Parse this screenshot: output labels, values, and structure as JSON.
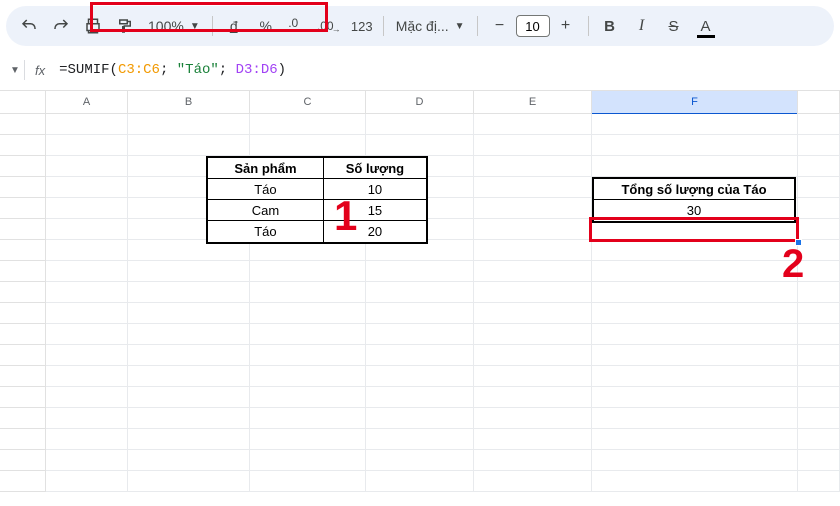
{
  "toolbar": {
    "zoom": "100%",
    "decimal_btn_a": ".0",
    "decimal_btn_b": ".00",
    "num_format": "123",
    "font": "Mặc đị...",
    "size_minus": "−",
    "size_value": "10",
    "size_plus": "+",
    "bold": "B",
    "italic": "I"
  },
  "formula_bar": {
    "fx": "fx",
    "eq": "=",
    "fn": "SUMIF",
    "open": "(",
    "range1": "C3:C6",
    "sep": "; ",
    "criteria": "\"Táo\"",
    "range2": "D3:D6",
    "close": ")"
  },
  "columns": {
    "A": "A",
    "B": "B",
    "C": "C",
    "D": "D",
    "E": "E",
    "F": "F"
  },
  "callouts": {
    "one": "1",
    "two": "2"
  },
  "product_table": {
    "headers": {
      "product": "Sản phẩm",
      "qty": "Số lượng"
    },
    "rows": [
      {
        "product": "Táo",
        "qty": "10"
      },
      {
        "product": "Cam",
        "qty": "15"
      },
      {
        "product": "Táo",
        "qty": "20"
      }
    ]
  },
  "summary": {
    "header": "Tổng số lượng của Táo",
    "value": "30"
  },
  "chart_data": {
    "type": "table",
    "title": "Sản phẩm / Số lượng",
    "series": [
      {
        "name": "Sản phẩm",
        "values": [
          "Táo",
          "Cam",
          "Táo"
        ]
      },
      {
        "name": "Số lượng",
        "values": [
          10,
          15,
          20
        ]
      }
    ],
    "derived": {
      "label": "Tổng số lượng của Táo",
      "formula": "=SUMIF(C3:C6; \"Táo\"; D3:D6)",
      "value": 30
    }
  }
}
